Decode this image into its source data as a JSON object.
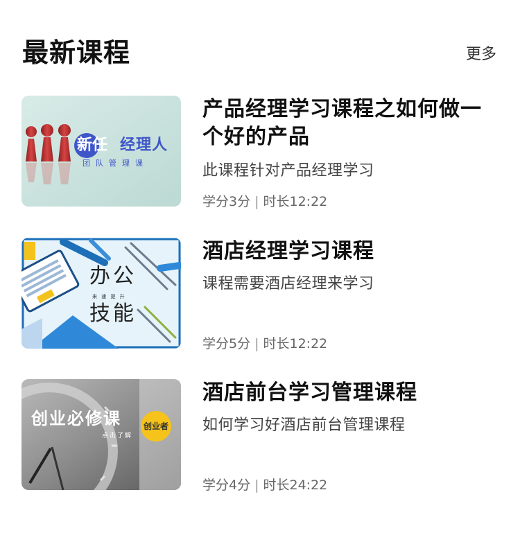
{
  "section": {
    "title": "最新课程",
    "more_label": "更多"
  },
  "courses": [
    {
      "title": "产品经理学习课程之如何做一个好的产品",
      "description": "此课程针对产品经理学习",
      "credits": "学分3分",
      "duration": "时长12:22",
      "thumbnail": {
        "headline_blue": "新任",
        "headline_rest": "经理人",
        "subline": "团队管理课",
        "icon": "red-chess-pieces"
      }
    },
    {
      "title": "酒店经理学习课程",
      "description": "课程需要酒店经理来学习",
      "credits": "学分5分",
      "duration": "时长12:22",
      "thumbnail": {
        "line1": "办公",
        "line2": "技能",
        "small_text": "来 速 提 升",
        "icon": "laptop-stationery-illustration"
      }
    },
    {
      "title": "酒店前台学习管理课程",
      "description": "如何学习好酒店前台管理课程",
      "credits": "学分4分",
      "duration": "时长24:22",
      "thumbnail": {
        "headline": "创业必修课",
        "badge": "创业者",
        "subline": "点击了解",
        "icon": "clock-grayscale-photo"
      }
    }
  ],
  "colors": {
    "accent_blue": "#3f56c9",
    "badge_yellow": "#f6c31b",
    "thumb1_bg": "#cde3df",
    "thumb2_bg": "#e6f3fb"
  }
}
